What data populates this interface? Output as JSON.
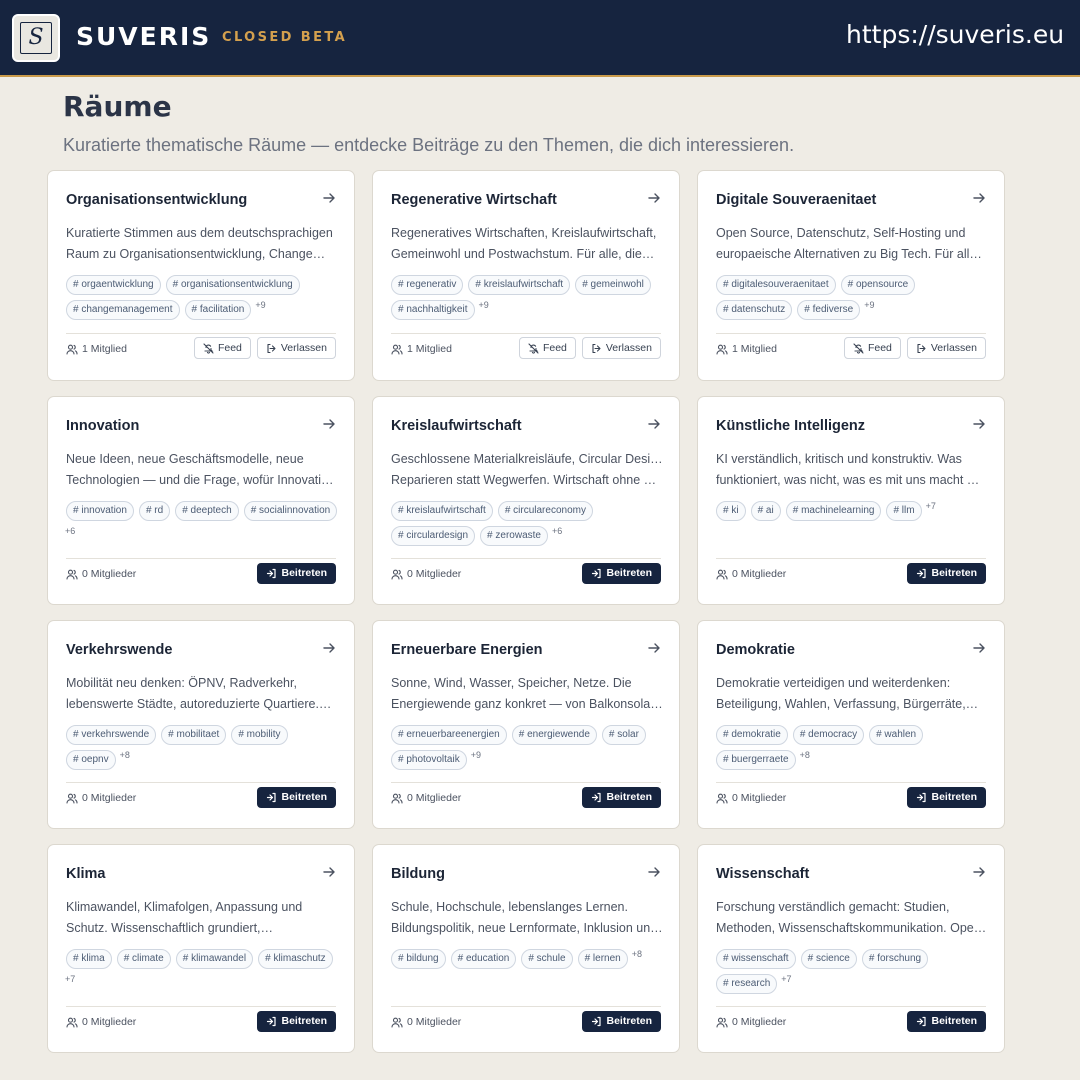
{
  "header": {
    "logo_letter": "S",
    "brand": "SUVERIS",
    "badge": "CLOSED BETA",
    "url": "https://suveris.eu"
  },
  "page": {
    "title": "Räume",
    "subtitle": "Kuratierte thematische Räume — entdecke Beiträge zu den Themen, die dich interessieren."
  },
  "labels": {
    "feed": "Feed",
    "leave": "Verlassen",
    "join": "Beitreten"
  },
  "icons": {
    "arrow": "arrow-right-icon",
    "members": "users-icon",
    "feed": "bell-off-icon",
    "leave": "log-out-icon",
    "join": "log-in-icon"
  },
  "cards": [
    {
      "title": "Organisationsentwicklung",
      "desc": [
        "Kuratierte Stimmen aus dem deutschsprachigen",
        "Raum zu Organisationsentwicklung, Change…"
      ],
      "tags": [
        "orgaentwicklung",
        "organisationsentwicklung",
        "changemanagement",
        "facilitation"
      ],
      "more": "+9",
      "members": "1 Mitglied",
      "joined": true
    },
    {
      "title": "Regenerative Wirtschaft",
      "desc": [
        "Regeneratives Wirtschaften, Kreislaufwirtschaft,",
        "Gemeinwohl und Postwachstum. Für alle, die…"
      ],
      "tags": [
        "regenerativ",
        "kreislaufwirtschaft",
        "gemeinwohl",
        "nachhaltigkeit"
      ],
      "more": "+9",
      "members": "1 Mitglied",
      "joined": true
    },
    {
      "title": "Digitale Souveraenitaet",
      "desc": [
        "Open Source, Datenschutz, Self-Hosting und",
        "europaeische Alternativen zu Big Tech. Für alle,…"
      ],
      "tags": [
        "digitalesouveraenitaet",
        "opensource",
        "datenschutz",
        "fediverse"
      ],
      "more": "+9",
      "members": "1 Mitglied",
      "joined": true
    },
    {
      "title": "Innovation",
      "desc": [
        "Neue Ideen, neue Geschäftsmodelle, neue",
        "Technologien — und die Frage, wofür Innovatio…"
      ],
      "tags": [
        "innovation",
        "rd",
        "deeptech",
        "socialinnovation"
      ],
      "more": "+6",
      "members": "0 Mitglieder",
      "joined": false
    },
    {
      "title": "Kreislaufwirtschaft",
      "desc": [
        "Geschlossene Materialkreisläufe, Circular Design,",
        "Reparieren statt Wegwerfen. Wirtschaft ohne M…"
      ],
      "tags": [
        "kreislaufwirtschaft",
        "circulareconomy",
        "circulardesign",
        "zerowaste"
      ],
      "more": "+6",
      "members": "0 Mitglieder",
      "joined": false
    },
    {
      "title": "Künstliche Intelligenz",
      "desc": [
        "KI verständlich, kritisch und konstruktiv. Was",
        "funktioniert, was nicht, was es mit uns macht —…"
      ],
      "tags": [
        "ki",
        "ai",
        "machinelearning",
        "llm"
      ],
      "more": "+7",
      "members": "0 Mitglieder",
      "joined": false
    },
    {
      "title": "Verkehrswende",
      "desc": [
        "Mobilität neu denken: ÖPNV, Radverkehr,",
        "lebenswerte Städte, autoreduzierte Quartiere.…"
      ],
      "tags": [
        "verkehrswende",
        "mobilitaet",
        "mobility",
        "oepnv"
      ],
      "more": "+8",
      "members": "0 Mitglieder",
      "joined": false
    },
    {
      "title": "Erneuerbare Energien",
      "desc": [
        "Sonne, Wind, Wasser, Speicher, Netze. Die",
        "Energiewende ganz konkret — von Balkonsolar…"
      ],
      "tags": [
        "erneuerbareenergien",
        "energiewende",
        "solar",
        "photovoltaik"
      ],
      "more": "+9",
      "members": "0 Mitglieder",
      "joined": false
    },
    {
      "title": "Demokratie",
      "desc": [
        "Demokratie verteidigen und weiterdenken:",
        "Beteiligung, Wahlen, Verfassung, Bürgerräte,…"
      ],
      "tags": [
        "demokratie",
        "democracy",
        "wahlen",
        "buergerraete"
      ],
      "more": "+8",
      "members": "0 Mitglieder",
      "joined": false
    },
    {
      "title": "Klima",
      "desc": [
        "Klimawandel, Klimafolgen, Anpassung und",
        "Schutz. Wissenschaftlich grundiert,…"
      ],
      "tags": [
        "klima",
        "climate",
        "klimawandel",
        "klimaschutz"
      ],
      "more": "+7",
      "members": "0 Mitglieder",
      "joined": false
    },
    {
      "title": "Bildung",
      "desc": [
        "Schule, Hochschule, lebenslanges Lernen.",
        "Bildungspolitik, neue Lernformate, Inklusion un…"
      ],
      "tags": [
        "bildung",
        "education",
        "schule",
        "lernen"
      ],
      "more": "+8",
      "members": "0 Mitglieder",
      "joined": false
    },
    {
      "title": "Wissenschaft",
      "desc": [
        "Forschung verständlich gemacht: Studien,",
        "Methoden, Wissenschaftskommunikation. Ope…"
      ],
      "tags": [
        "wissenschaft",
        "science",
        "forschung",
        "research"
      ],
      "more": "+7",
      "members": "0 Mitglieder",
      "joined": false
    }
  ]
}
